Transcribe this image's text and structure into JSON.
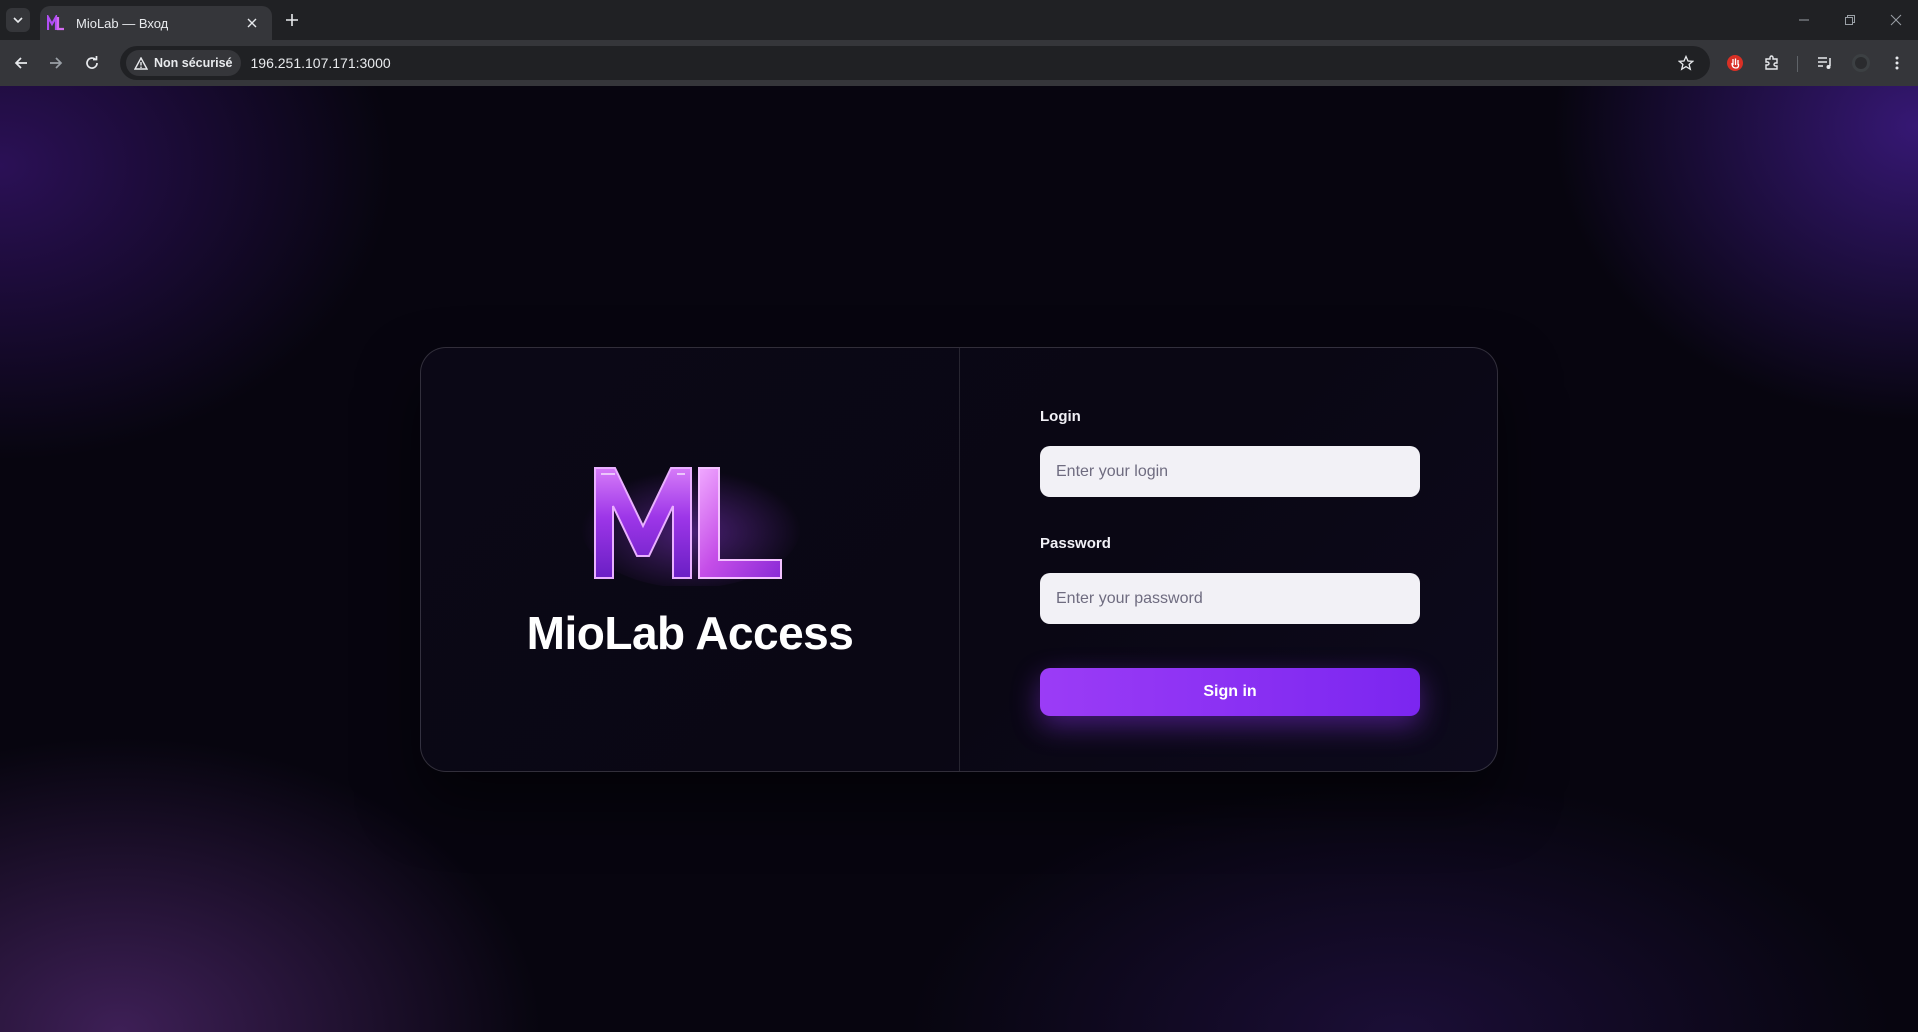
{
  "browser": {
    "tab_title": "MioLab — Вход",
    "security_label": "Non sécurisé",
    "url": "196.251.107.171:3000"
  },
  "colors": {
    "accent": "#8b2ff3",
    "background": "#07050f",
    "card": "#0b0816"
  },
  "brand": {
    "logo_text": "ML",
    "title": "MioLab Access"
  },
  "form": {
    "login_label": "Login",
    "login_placeholder": "Enter your login",
    "login_value": "",
    "password_label": "Password",
    "password_placeholder": "Enter your password",
    "password_value": "",
    "submit_label": "Sign in"
  }
}
